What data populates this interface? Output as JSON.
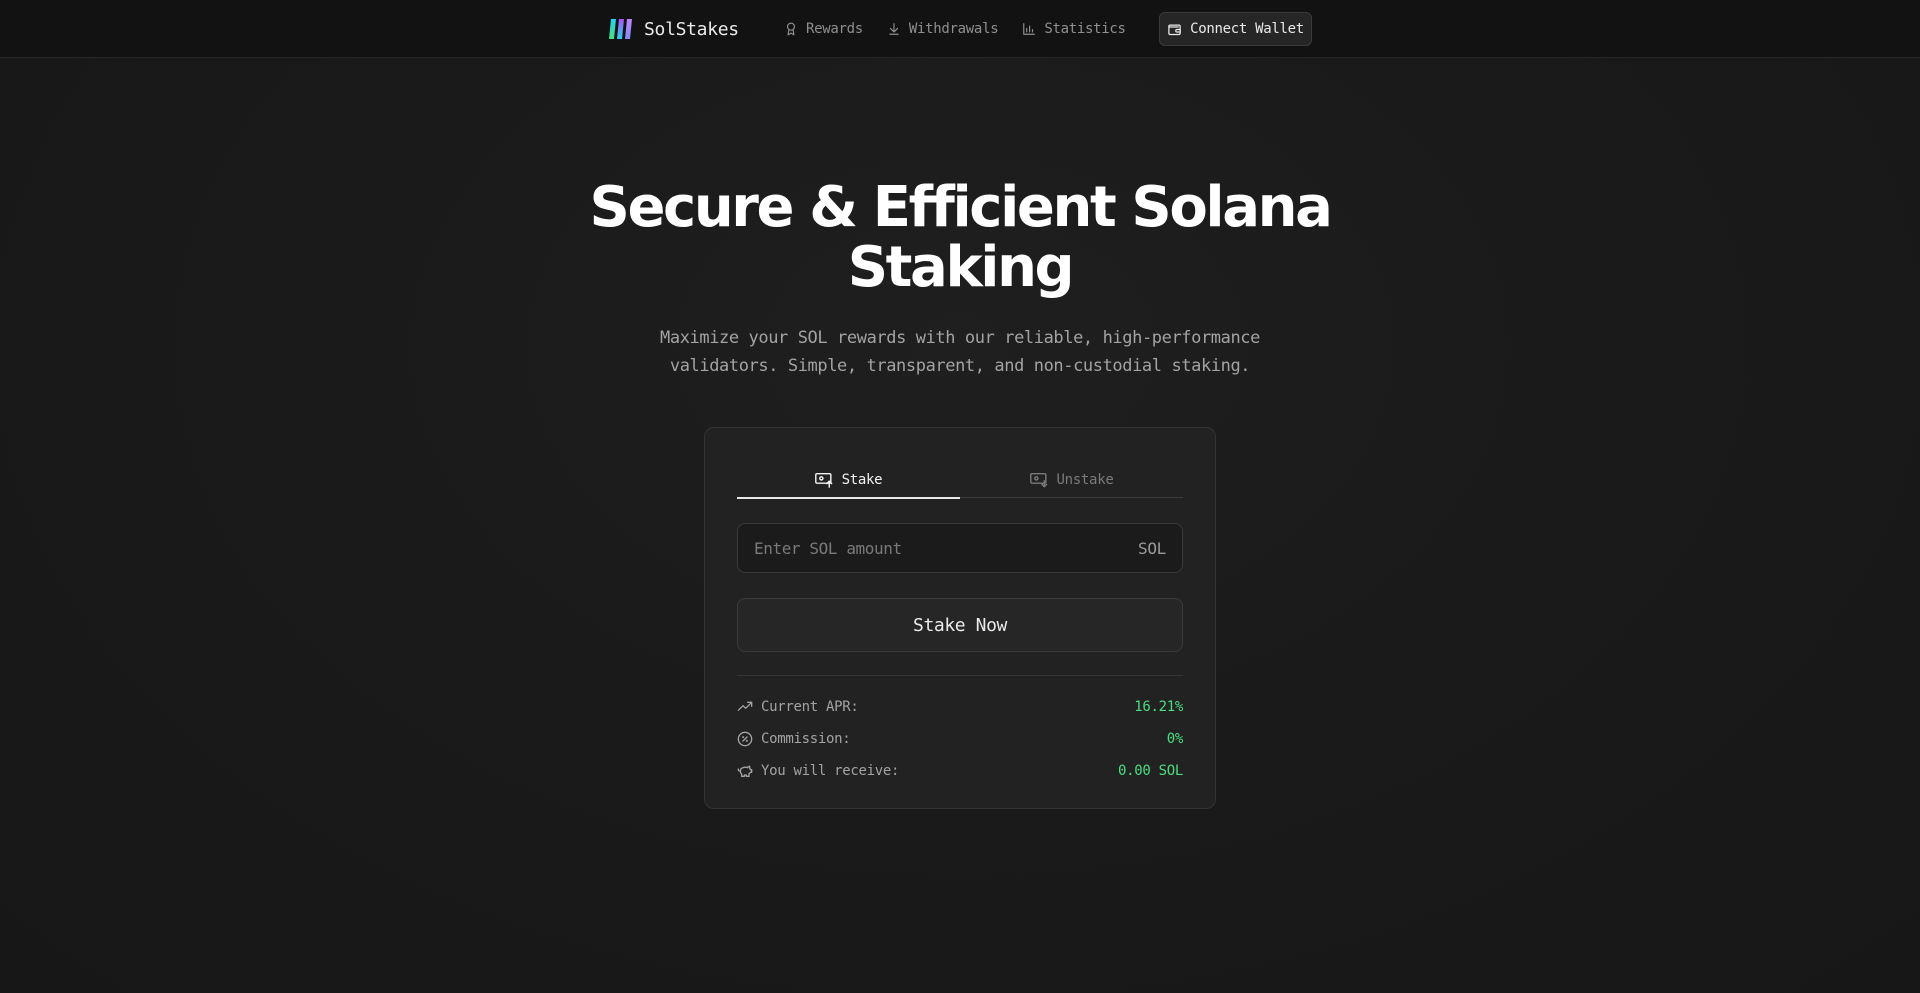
{
  "nav": {
    "brand": "SolStakes",
    "links": [
      {
        "label": "Rewards",
        "icon": "award-icon"
      },
      {
        "label": "Withdrawals",
        "icon": "download-icon"
      },
      {
        "label": "Statistics",
        "icon": "bar-chart-icon"
      }
    ],
    "connect_label": "Connect Wallet"
  },
  "hero": {
    "title_line1": "Secure & Efficient Solana",
    "title_line2": "Staking",
    "subtitle_line1": "Maximize your SOL rewards with our reliable, high-performance",
    "subtitle_line2": "validators. Simple, transparent, and non-custodial staking."
  },
  "card": {
    "tabs": [
      {
        "label": "Stake",
        "active": true
      },
      {
        "label": "Unstake",
        "active": false
      }
    ],
    "amount": {
      "placeholder": "Enter SOL amount",
      "value": "",
      "unit": "SOL"
    },
    "submit_label": "Stake Now",
    "stats": [
      {
        "label": "Current APR:",
        "value": "16.21%",
        "icon": "trending-up-icon"
      },
      {
        "label": "Commission:",
        "value": "0%",
        "icon": "percent-badge-icon"
      },
      {
        "label": "You will receive:",
        "value": "0.00 SOL",
        "icon": "piggy-bank-icon"
      }
    ]
  },
  "colors": {
    "background": "#1a1a1a",
    "nav_background": "#121212",
    "card_background": "#222222",
    "accent_green": "#4ade80",
    "logo_gradient": [
      "#22d3ee",
      "#a855f7",
      "#4ade80"
    ]
  }
}
